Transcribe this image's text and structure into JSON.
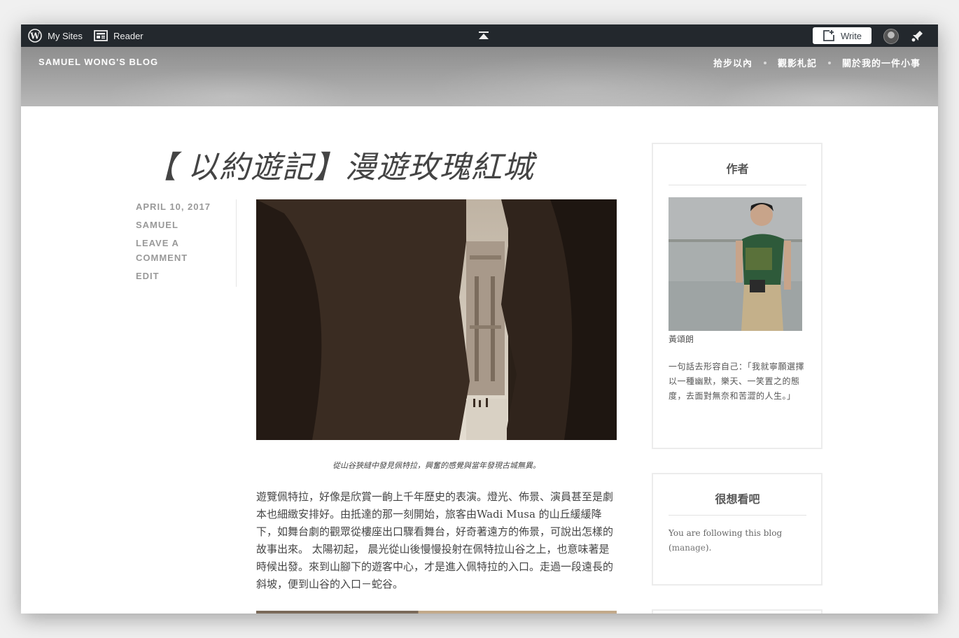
{
  "adminbar": {
    "my_sites": "My Sites",
    "reader": "Reader",
    "write": "Write"
  },
  "header": {
    "site_title": "SAMUEL WONG'S BLOG",
    "nav": [
      "拾步以內",
      "觀影札記",
      "關於我的一件小事"
    ]
  },
  "post": {
    "title": "【 以約遊記】漫遊玫瑰紅城",
    "meta": {
      "date": "APRIL 10, 2017",
      "author": "SAMUEL",
      "comment": "LEAVE A COMMENT",
      "edit": "EDIT"
    },
    "caption": "從山谷狹縫中發見佩特拉，興奮的感覺與當年發現古城無異。",
    "body": "遊覽佩特拉，好像是欣賞一齣上千年歷史的表演。燈光、佈景、演員甚至是劇本也細緻安排好。由抵達的那一刻開始，旅客由Wadi Musa 的山丘緩緩降下，如舞台劇的觀眾從樓座出口驟看舞台，好奇著遠方的佈景，可說出怎樣的故事出來。 太陽初起， 晨光從山後慢慢投射在佩特拉山谷之上，也意味著是時候出發。來到山腳下的遊客中心，才是進入佩特拉的入口。走過一段遠長的斜坡，便到山谷的入口－蛇谷。"
  },
  "sidebar": {
    "author_widget": {
      "title": "作者",
      "name": "黃頌朗",
      "bio": "一句話去形容自己：「我就寧願選擇以一種幽默，樂天、一笑置之的態度，去面對無奈和苦澀的人生。」"
    },
    "follow_widget": {
      "title": "很想看吧",
      "text_before": "You are following this blog (",
      "link": "manage",
      "text_after": ")."
    }
  }
}
